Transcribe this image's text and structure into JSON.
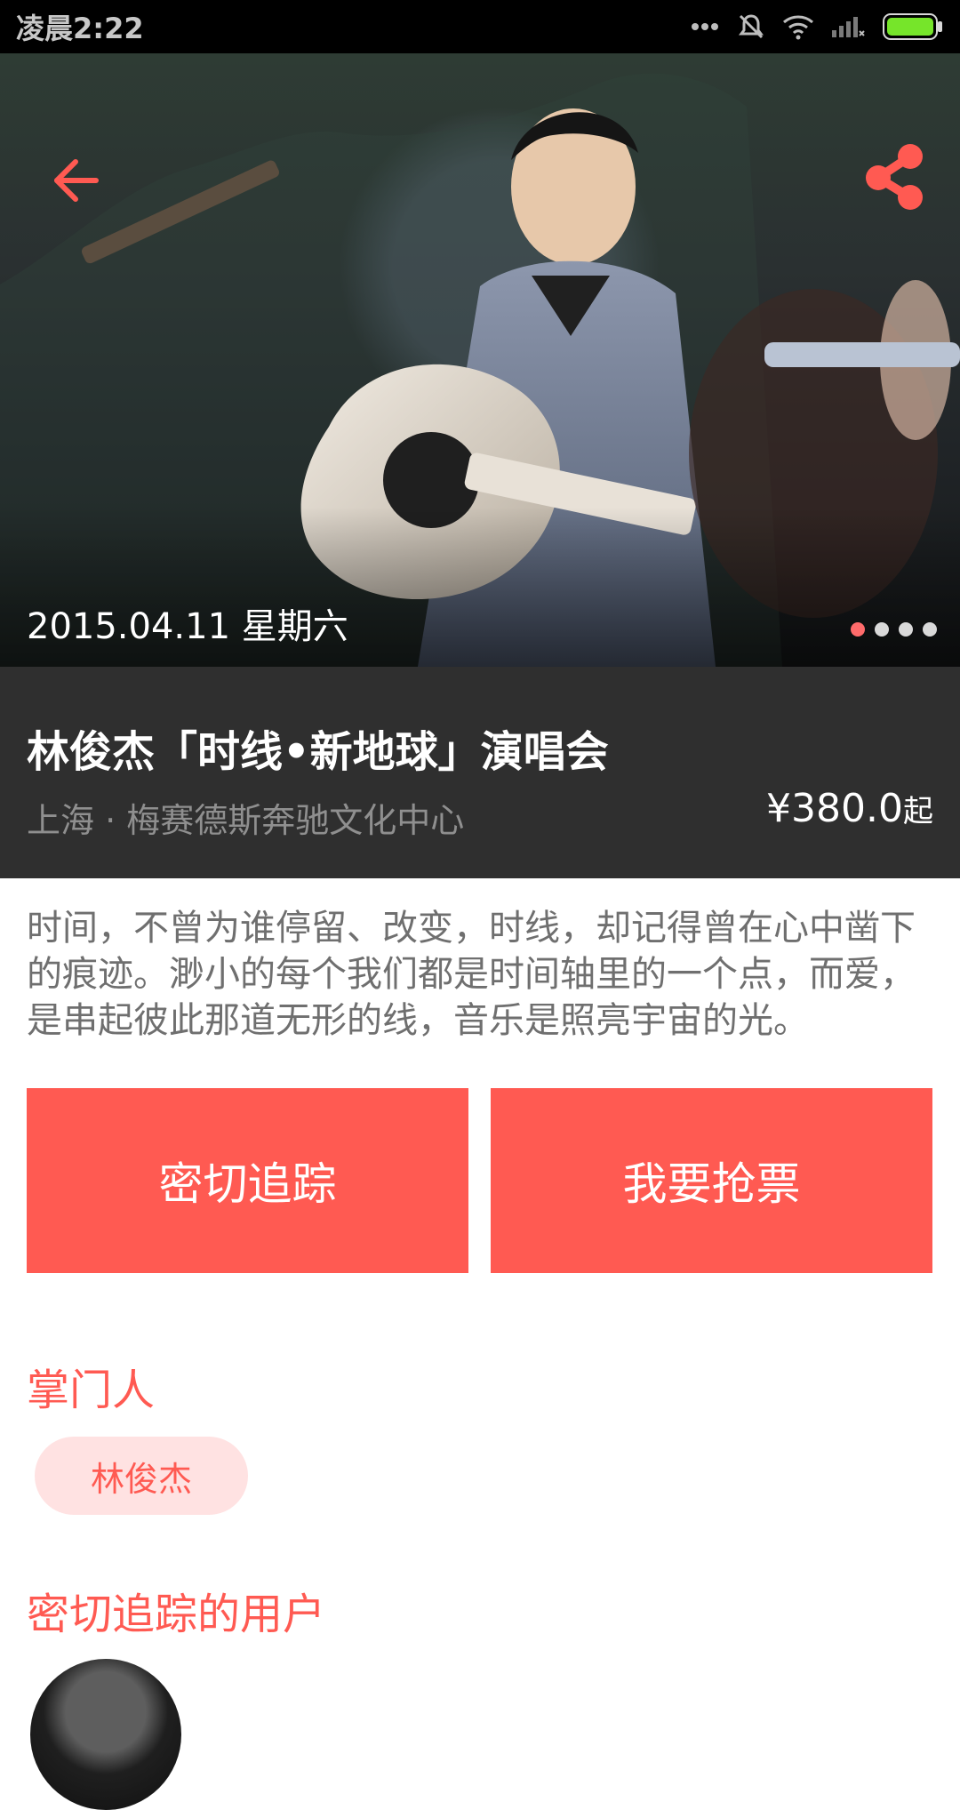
{
  "status_bar": {
    "time": "凌晨2:22"
  },
  "hero": {
    "date": "2015.04.11 星期六",
    "carousel_page": 1,
    "carousel_total": 4
  },
  "event": {
    "title": "林俊杰「时线•新地球」演唱会",
    "venue": "上海 · 梅赛德斯奔驰文化中心",
    "price": "¥380.0",
    "price_suffix": "起"
  },
  "description": {
    "text": "时间，不曾为谁停留、改变，时线，却记得曾在心中凿下的痕迹。渺小的每个我们都是时间轴里的一个点，而爱，是串起彼此那道无形的线，音乐是照亮宇宙的光。"
  },
  "actions": {
    "follow_label": "密切追踪",
    "buy_label": "我要抢票"
  },
  "host_section": {
    "title": "掌门人",
    "host_name": "林俊杰"
  },
  "followers_section": {
    "title": "密切追踪的用户"
  },
  "colors": {
    "accent": "#ff5a52",
    "accent_light": "#ffe2e2",
    "title_band": "#2f2f2f",
    "status_bar": "#000000",
    "battery": "#76e52a"
  },
  "icons": {
    "back": "arrow-left-icon",
    "share": "share-icon",
    "signal": "signal-icon",
    "wifi": "wifi-icon",
    "silent": "silent-bell-icon",
    "battery": "battery-icon"
  }
}
